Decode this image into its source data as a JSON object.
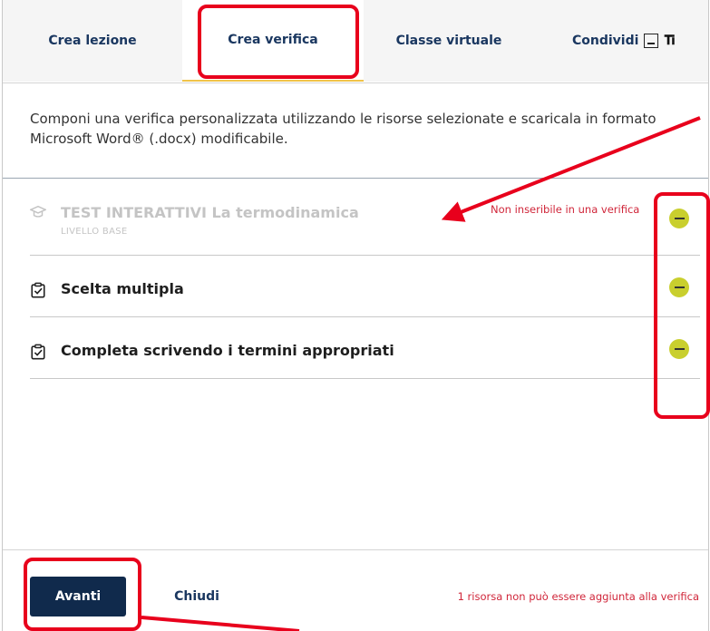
{
  "tabs": [
    {
      "label": "Crea lezione",
      "active": false
    },
    {
      "label": "Crea verifica",
      "active": true
    },
    {
      "label": "Classe virtuale",
      "active": false
    },
    {
      "label": "Condividi",
      "active": false
    }
  ],
  "share_icons": [
    "share-screen-icon",
    "teams-icon"
  ],
  "description": "Componi una verifica personalizzata utilizzando le risorse selezionate e scaricala in formato Microsoft Word® (.docx) modificabile.",
  "items": [
    {
      "icon": "graduation-cap-icon",
      "title": "TEST INTERATTIVI La termodinamica",
      "subtitle": "LIVELLO BASE",
      "warning": "Non inseribile in una verifica",
      "disabled": true
    },
    {
      "icon": "clipboard-check-icon",
      "title": "Scelta multipla",
      "disabled": false
    },
    {
      "icon": "clipboard-check-icon",
      "title": "Completa scrivendo i termini appropriati",
      "disabled": false
    }
  ],
  "footer": {
    "primary_label": "Avanti",
    "secondary_label": "Chiudi",
    "note": "1 risorsa non può essere aggiunta alla verifica"
  },
  "colors": {
    "primary_button": "#102a4c",
    "tab_text": "#1a3760",
    "active_tab_underline": "#f0c34a",
    "remove_button": "#c9cf2e",
    "warning_text": "#d0263a",
    "annotation": "#e8001c"
  }
}
